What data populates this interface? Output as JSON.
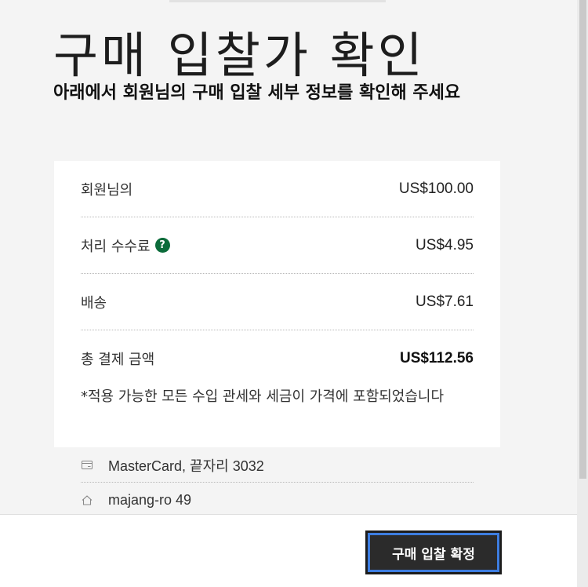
{
  "page": {
    "title": "구매 입찰가 확인",
    "subtitle": "아래에서 회원님의 구매 입찰 세부 정보를 확인해 주세요"
  },
  "summary": {
    "bid": {
      "label": "회원님의",
      "value": "US$100.00"
    },
    "fee": {
      "label": "처리 수수료",
      "value": "US$4.95",
      "help_icon": "question-circle-icon"
    },
    "shipping": {
      "label": "배송",
      "value": "US$7.61"
    },
    "total": {
      "label": "총 결제 금액",
      "value": "US$112.56"
    },
    "note": "*적용 가능한 모든 수입 관세와 세금이 가격에 포함되었습니다"
  },
  "payment": {
    "icon": "credit-card-icon",
    "text": "MasterCard, 끝자리 3032"
  },
  "address": {
    "icon": "home-icon",
    "text": "majang-ro 49"
  },
  "footer": {
    "confirm_label": "구매 입찰 확정"
  },
  "colors": {
    "help_icon": "#0b6b3a",
    "button_bg": "#2b2b2b",
    "button_focus": "#3d7de0"
  }
}
